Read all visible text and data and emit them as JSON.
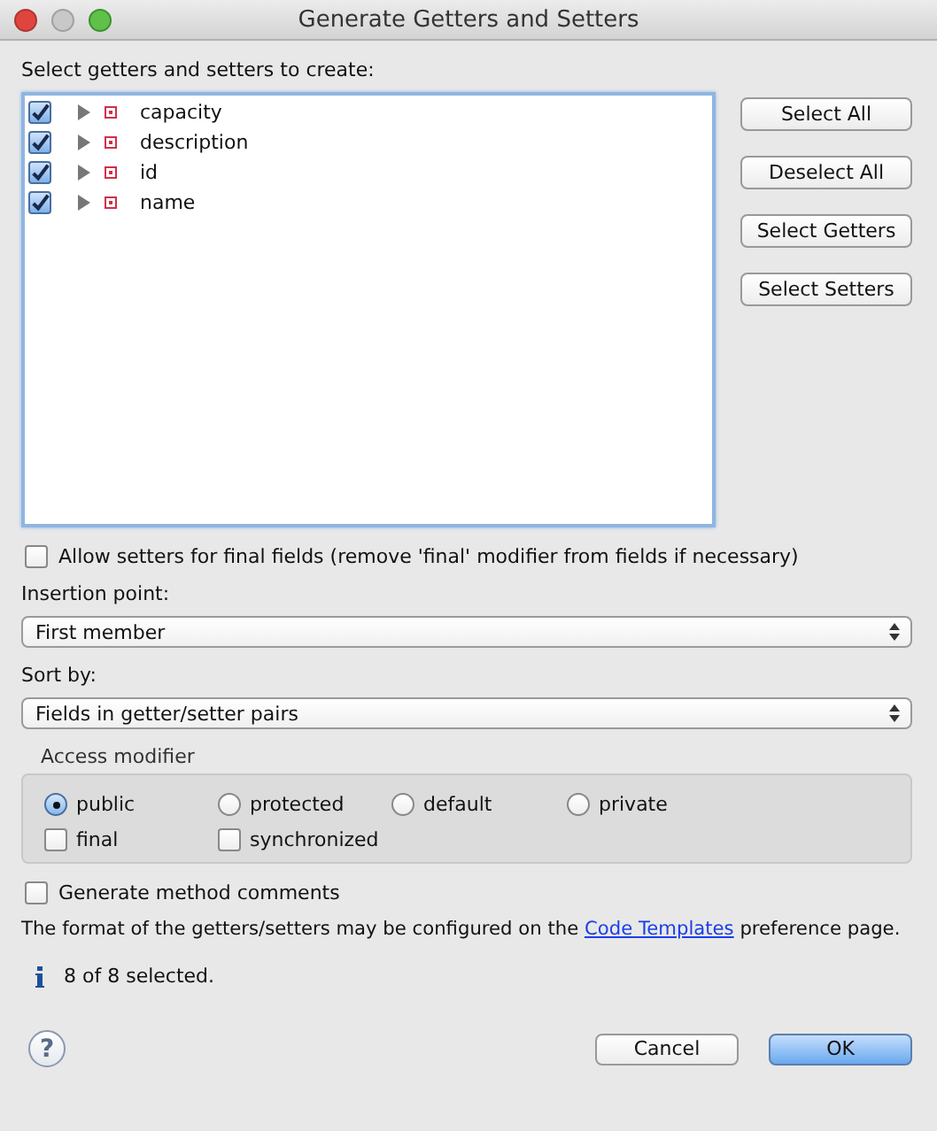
{
  "window": {
    "title": "Generate Getters and Setters"
  },
  "tree_label": "Select getters and setters to create:",
  "fields": [
    {
      "name": "capacity",
      "checked": true,
      "expanded": false
    },
    {
      "name": "description",
      "checked": true,
      "expanded": false
    },
    {
      "name": "id",
      "checked": true,
      "expanded": false
    },
    {
      "name": "name",
      "checked": true,
      "expanded": false
    }
  ],
  "side_buttons": [
    "Select All",
    "Deselect All",
    "Select Getters",
    "Select Setters"
  ],
  "allow_final": {
    "label": "Allow setters for final fields (remove 'final' modifier from fields if necessary)",
    "checked": false
  },
  "insertion_point": {
    "label": "Insertion point:",
    "value": "First member"
  },
  "sort_by": {
    "label": "Sort by:",
    "value": "Fields in getter/setter pairs"
  },
  "access_modifier": {
    "title": "Access modifier",
    "options": [
      {
        "label": "public",
        "selected": true
      },
      {
        "label": "protected",
        "selected": false
      },
      {
        "label": "default",
        "selected": false
      },
      {
        "label": "private",
        "selected": false
      }
    ],
    "flags": [
      {
        "label": "final",
        "checked": false
      },
      {
        "label": "synchronized",
        "checked": false
      }
    ]
  },
  "method_comments": {
    "label": "Generate method comments",
    "checked": false
  },
  "format_note": {
    "before": "The format of the getters/setters may be configured on the ",
    "link": "Code Templates",
    "after": " preference page."
  },
  "status": "8 of 8 selected.",
  "help_button": "?",
  "buttons": [
    {
      "label": "Cancel",
      "kind": "normal"
    },
    {
      "label": "OK",
      "kind": "default"
    }
  ]
}
